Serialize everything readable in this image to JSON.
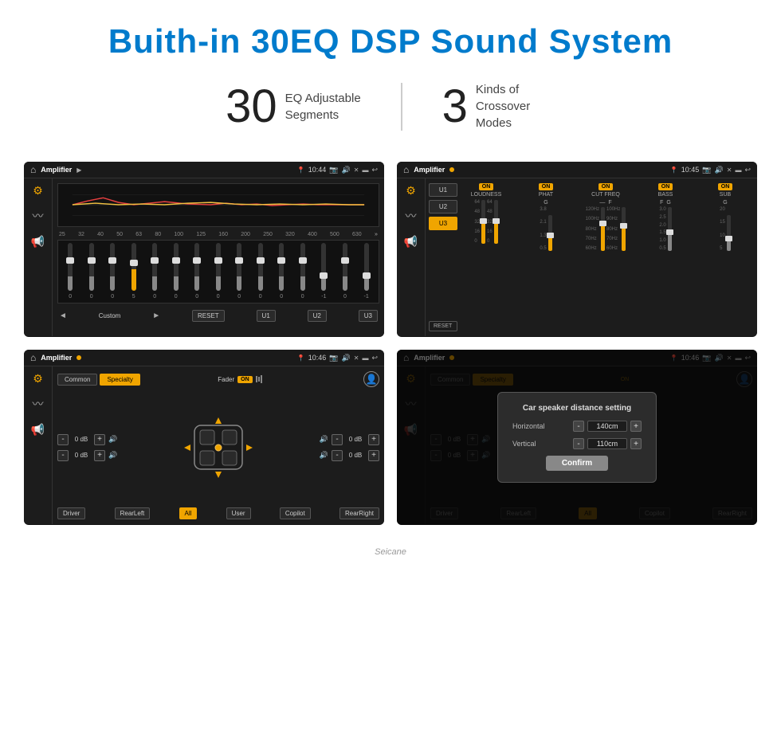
{
  "page": {
    "title": "Buith-in 30EQ DSP Sound System",
    "stat1_number": "30",
    "stat1_label_line1": "EQ Adjustable",
    "stat1_label_line2": "Segments",
    "stat2_number": "3",
    "stat2_label_line1": "Kinds of",
    "stat2_label_line2": "Crossover Modes",
    "watermark": "Seicane"
  },
  "screen1": {
    "app_name": "Amplifier",
    "time": "10:44",
    "eq_freqs": [
      "25",
      "32",
      "40",
      "50",
      "63",
      "80",
      "100",
      "125",
      "160",
      "200",
      "250",
      "320",
      "400",
      "500",
      "630"
    ],
    "eq_values": [
      "0",
      "0",
      "0",
      "5",
      "0",
      "0",
      "0",
      "0",
      "0",
      "0",
      "0",
      "0",
      "-1",
      "0",
      "-1"
    ],
    "preset_label": "Custom",
    "btns": [
      "RESET",
      "U1",
      "U2",
      "U3"
    ]
  },
  "screen2": {
    "app_name": "Amplifier",
    "time": "10:45",
    "presets": [
      "U1",
      "U2",
      "U3"
    ],
    "active_preset": "U3",
    "bands": [
      "LOUDNESS",
      "PHAT",
      "CUT FREQ",
      "BASS",
      "SUB"
    ],
    "reset_label": "RESET"
  },
  "screen3": {
    "app_name": "Amplifier",
    "time": "10:46",
    "tab_common": "Common",
    "tab_specialty": "Specialty",
    "fader_label": "Fader",
    "fader_on": "ON",
    "db_values": [
      "0 dB",
      "0 dB",
      "0 dB",
      "0 dB"
    ],
    "btns_bottom": [
      "Driver",
      "RearLeft",
      "All",
      "User",
      "Copilot",
      "RearRight"
    ]
  },
  "screen4": {
    "app_name": "Amplifier",
    "time": "10:46",
    "tab_common": "Common",
    "tab_specialty": "Specialty",
    "dialog": {
      "title": "Car speaker distance setting",
      "horizontal_label": "Horizontal",
      "horizontal_value": "140cm",
      "vertical_label": "Vertical",
      "vertical_value": "110cm",
      "confirm_label": "Confirm"
    },
    "db_values": [
      "0 dB",
      "0 dB"
    ],
    "btns_bottom": [
      "Driver",
      "RearLeft",
      "All",
      "Copilot",
      "RearRight"
    ]
  }
}
